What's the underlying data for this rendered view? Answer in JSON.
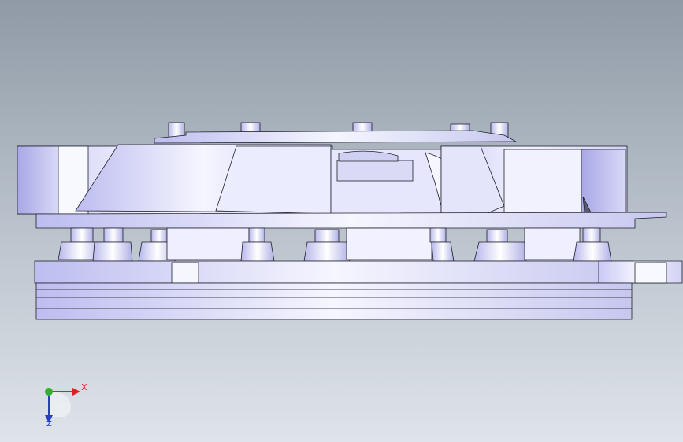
{
  "viewport": {
    "background_top": "#8f9aa6",
    "background_bottom": "#dfe4ea",
    "model_name": "",
    "model_icon": "assembly-model"
  },
  "triad": {
    "x_label": "X",
    "z_label": "Z",
    "x_color": "#e02020",
    "y_color": "#30b030",
    "z_color": "#2a3fbf"
  }
}
